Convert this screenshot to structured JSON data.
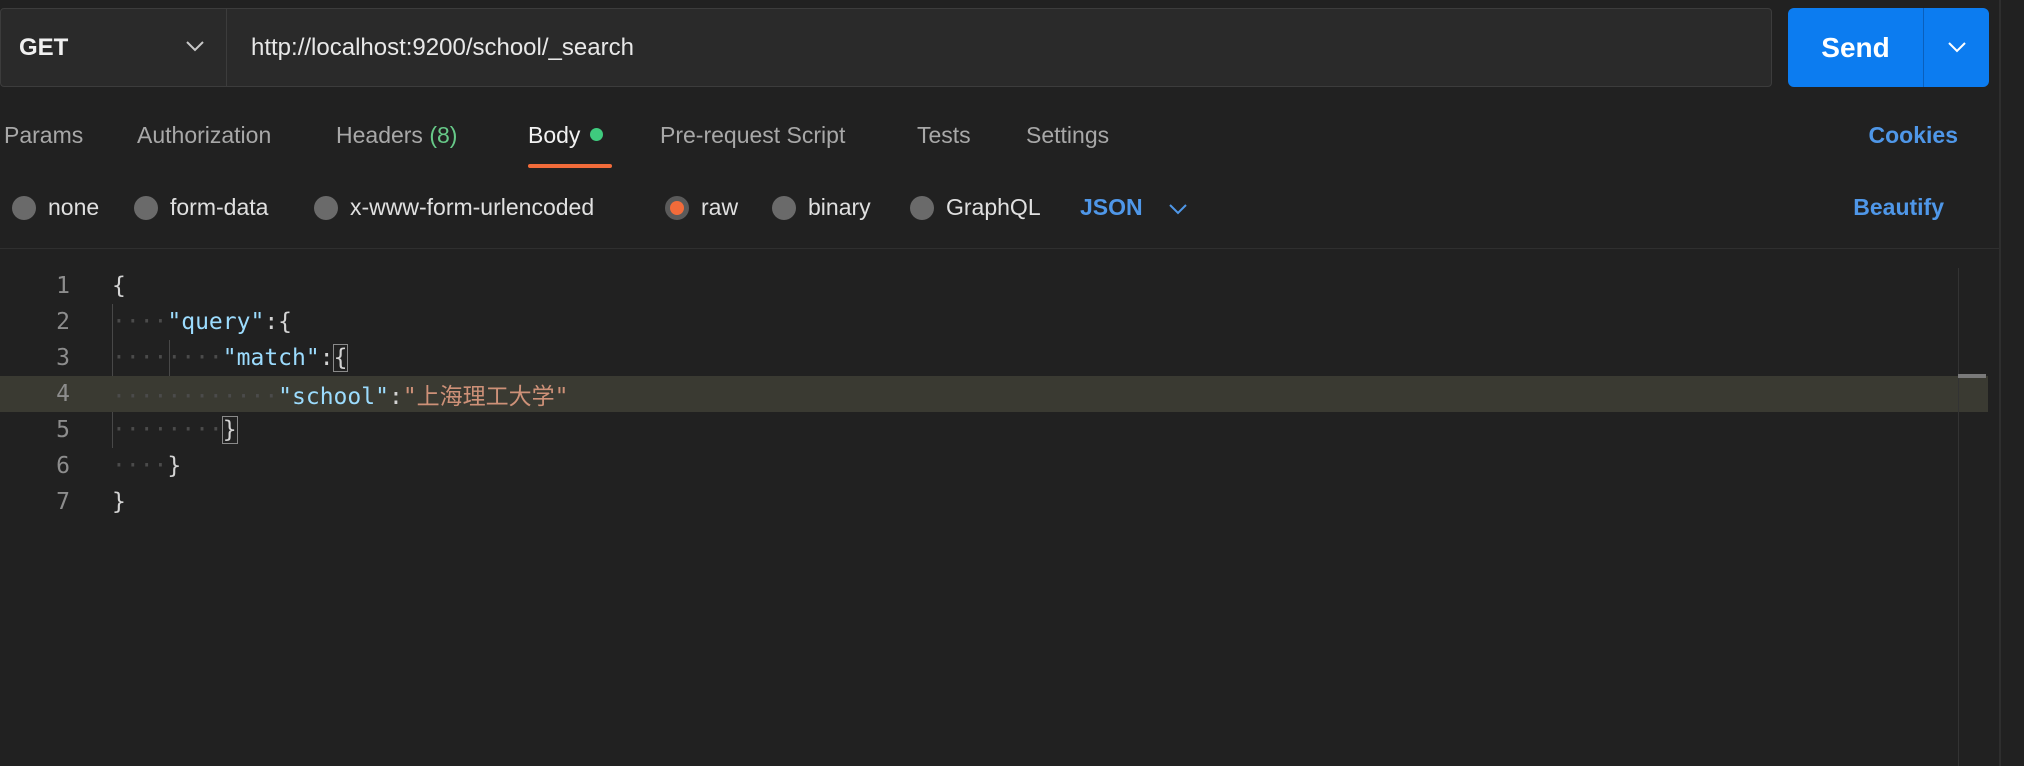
{
  "request": {
    "method": "GET",
    "url": "http://localhost:9200/school/_search",
    "send_label": "Send"
  },
  "tabs": [
    {
      "label": "Params"
    },
    {
      "label": "Authorization"
    },
    {
      "label": "Headers",
      "count": "(8)"
    },
    {
      "label": "Body",
      "active": true
    },
    {
      "label": "Pre-request Script"
    },
    {
      "label": "Tests"
    },
    {
      "label": "Settings"
    }
  ],
  "cookies_label": "Cookies",
  "body_types": [
    {
      "label": "none",
      "checked": false
    },
    {
      "label": "form-data",
      "checked": false
    },
    {
      "label": "x-www-form-urlencoded",
      "checked": false
    },
    {
      "label": "raw",
      "checked": true
    },
    {
      "label": "binary",
      "checked": false
    },
    {
      "label": "GraphQL",
      "checked": false
    }
  ],
  "language": "JSON",
  "beautify_label": "Beautify",
  "editor": {
    "line_numbers": [
      "1",
      "2",
      "3",
      "4",
      "5",
      "6",
      "7"
    ],
    "lines": [
      {
        "brace": "{"
      },
      {
        "key": "\"query\"",
        "sep": ":{"
      },
      {
        "key": "\"match\"",
        "sep": ":",
        "brace": "{"
      },
      {
        "key": "\"school\"",
        "sep": ":",
        "value": "\"上海理工大学\""
      },
      {
        "brace": "}"
      },
      {
        "brace": "}"
      },
      {
        "brace": "}"
      }
    ]
  },
  "colors": {
    "accent": "#0c7cf0",
    "active_tab": "#f26b3a",
    "link": "#4f97e8",
    "status_dot": "#3fcb7e"
  }
}
